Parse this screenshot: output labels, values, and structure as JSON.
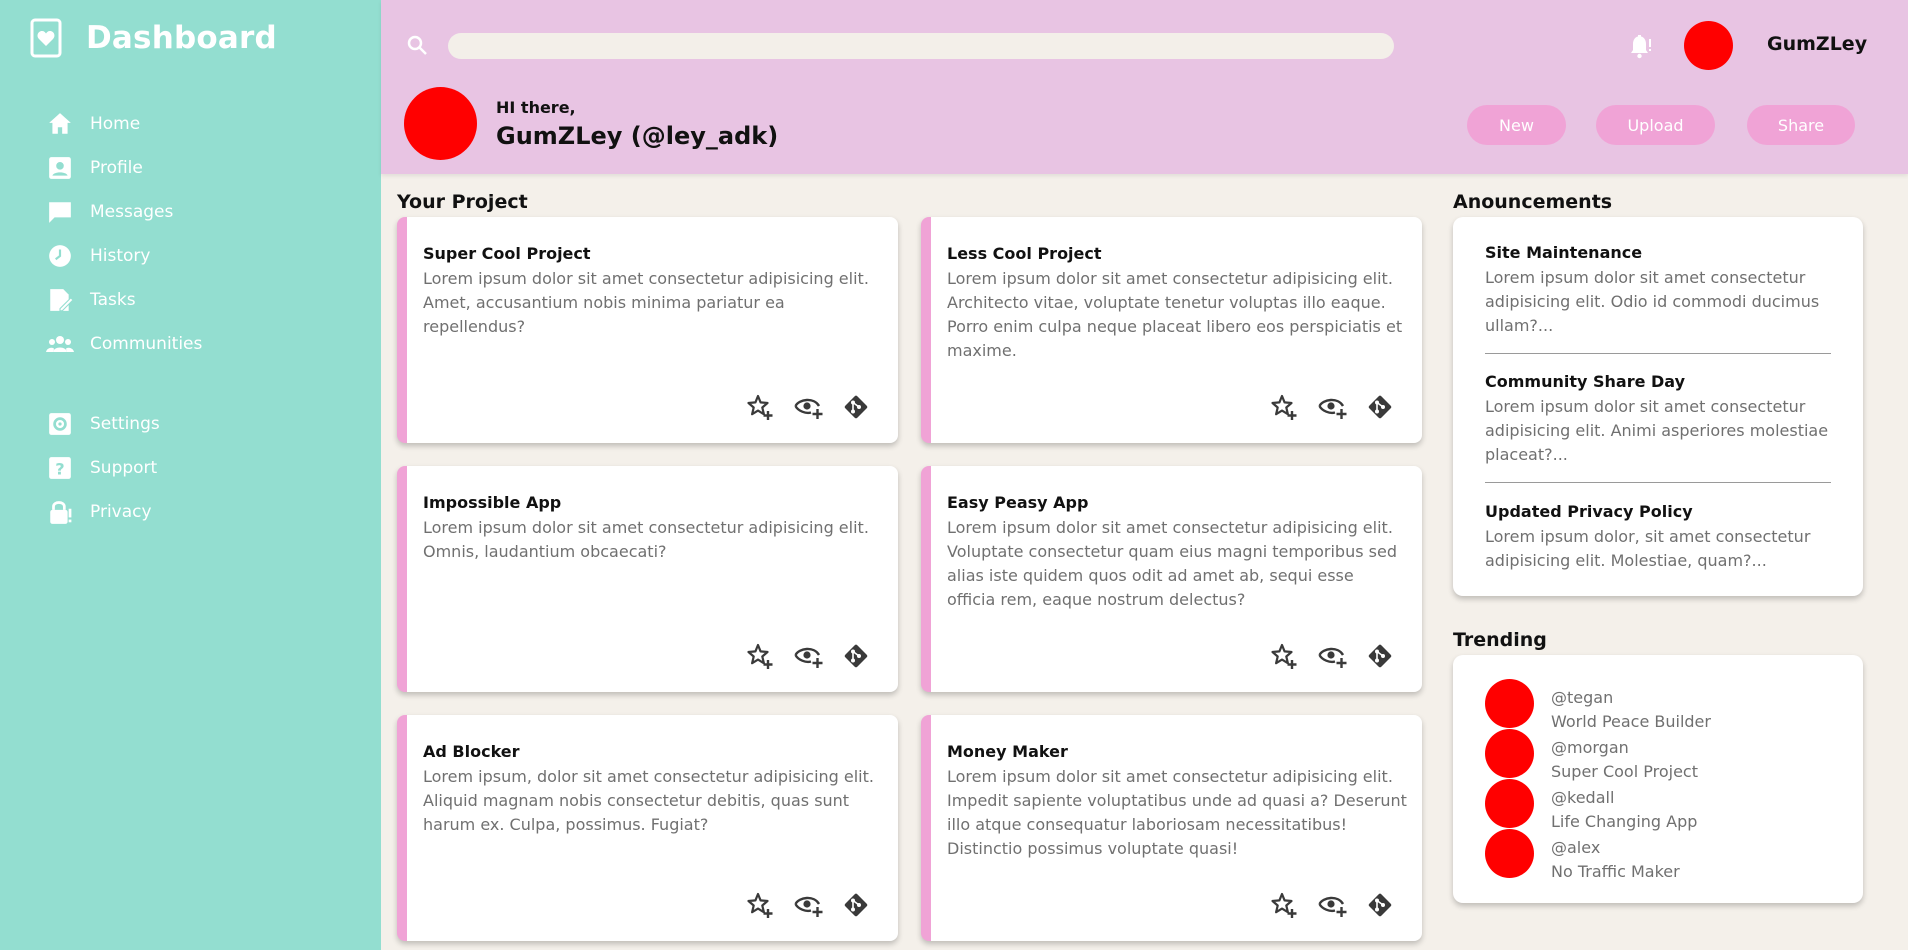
{
  "sidebar": {
    "title": "Dashboard",
    "items": [
      {
        "label": "Home",
        "icon": "home-icon"
      },
      {
        "label": "Profile",
        "icon": "profile-icon"
      },
      {
        "label": "Messages",
        "icon": "message-icon"
      },
      {
        "label": "History",
        "icon": "history-icon"
      },
      {
        "label": "Tasks",
        "icon": "tasks-icon"
      },
      {
        "label": "Communities",
        "icon": "communities-icon"
      }
    ],
    "secondary_items": [
      {
        "label": "Settings",
        "icon": "settings-icon"
      },
      {
        "label": "Support",
        "icon": "support-icon"
      },
      {
        "label": "Privacy",
        "icon": "privacy-icon"
      }
    ]
  },
  "header": {
    "search": {
      "placeholder": "",
      "value": ""
    },
    "username": "GumZLey",
    "greeting": "HI there,",
    "display_name": "GumZLey (@ley_adk)",
    "buttons": {
      "new": "New",
      "upload": "Upload",
      "share": "Share"
    }
  },
  "projects": {
    "title": "Your Project",
    "items": [
      {
        "title": "Super Cool Project",
        "description": "Lorem ipsum dolor sit amet consectetur adipisicing elit. Amet, accusantium nobis minima pariatur ea repellendus?"
      },
      {
        "title": "Less Cool Project",
        "description": "Lorem ipsum dolor sit amet consectetur adipisicing elit. Architecto vitae, voluptate tenetur voluptas illo eaque. Porro enim culpa neque placeat libero eos perspiciatis et maxime."
      },
      {
        "title": "Impossible App",
        "description": "Lorem ipsum dolor sit amet consectetur adipisicing elit. Omnis, laudantium obcaecati?"
      },
      {
        "title": "Easy Peasy App",
        "description": "Lorem ipsum dolor sit amet consectetur adipisicing elit. Voluptate consectetur quam eius magni temporibus sed alias iste quidem quos odit ad amet ab, sequi esse officia rem, eaque nostrum delectus?"
      },
      {
        "title": "Ad Blocker",
        "description": "Lorem ipsum, dolor sit amet consectetur adipisicing elit. Aliquid magnam nobis consectetur debitis, quas sunt harum ex. Culpa, possimus. Fugiat?"
      },
      {
        "title": "Money Maker",
        "description": "Lorem ipsum dolor sit amet consectetur adipisicing elit. Impedit sapiente voluptatibus unde ad quasi a? Deserunt illo atque consequatur laboriosam necessitatibus! Distinctio possimus voluptate quasi!"
      }
    ]
  },
  "announcements": {
    "title": "Anouncements",
    "items": [
      {
        "title": "Site Maintenance",
        "description": "Lorem ipsum dolor sit amet consectetur adipisicing elit. Odio id commodi ducimus ullam?..."
      },
      {
        "title": "Community Share Day",
        "description": "Lorem ipsum dolor sit amet consectetur adipisicing elit. Animi asperiores molestiae placeat?..."
      },
      {
        "title": "Updated Privacy Policy",
        "description": "Lorem ipsum dolor, sit amet consectetur adipisicing elit. Molestiae, quam?..."
      }
    ]
  },
  "trending": {
    "title": "Trending",
    "items": [
      {
        "handle": "@tegan",
        "project": "World Peace Builder"
      },
      {
        "handle": "@morgan",
        "project": "Super Cool Project"
      },
      {
        "handle": "@kedall",
        "project": "Life Changing App"
      },
      {
        "handle": "@alex",
        "project": "No Traffic Maker"
      }
    ]
  },
  "colors": {
    "sidebar_bg": "#93ded0",
    "header_bg": "#e8c4e3",
    "accent_pink": "#f0a3d6",
    "avatar_red": "#ff0000",
    "page_bg": "#f4f0ea"
  },
  "icons": {
    "card_actions": [
      "star-plus-icon",
      "eye-plus-icon",
      "git-icon"
    ],
    "header": [
      "search-icon",
      "bell-icon"
    ]
  }
}
